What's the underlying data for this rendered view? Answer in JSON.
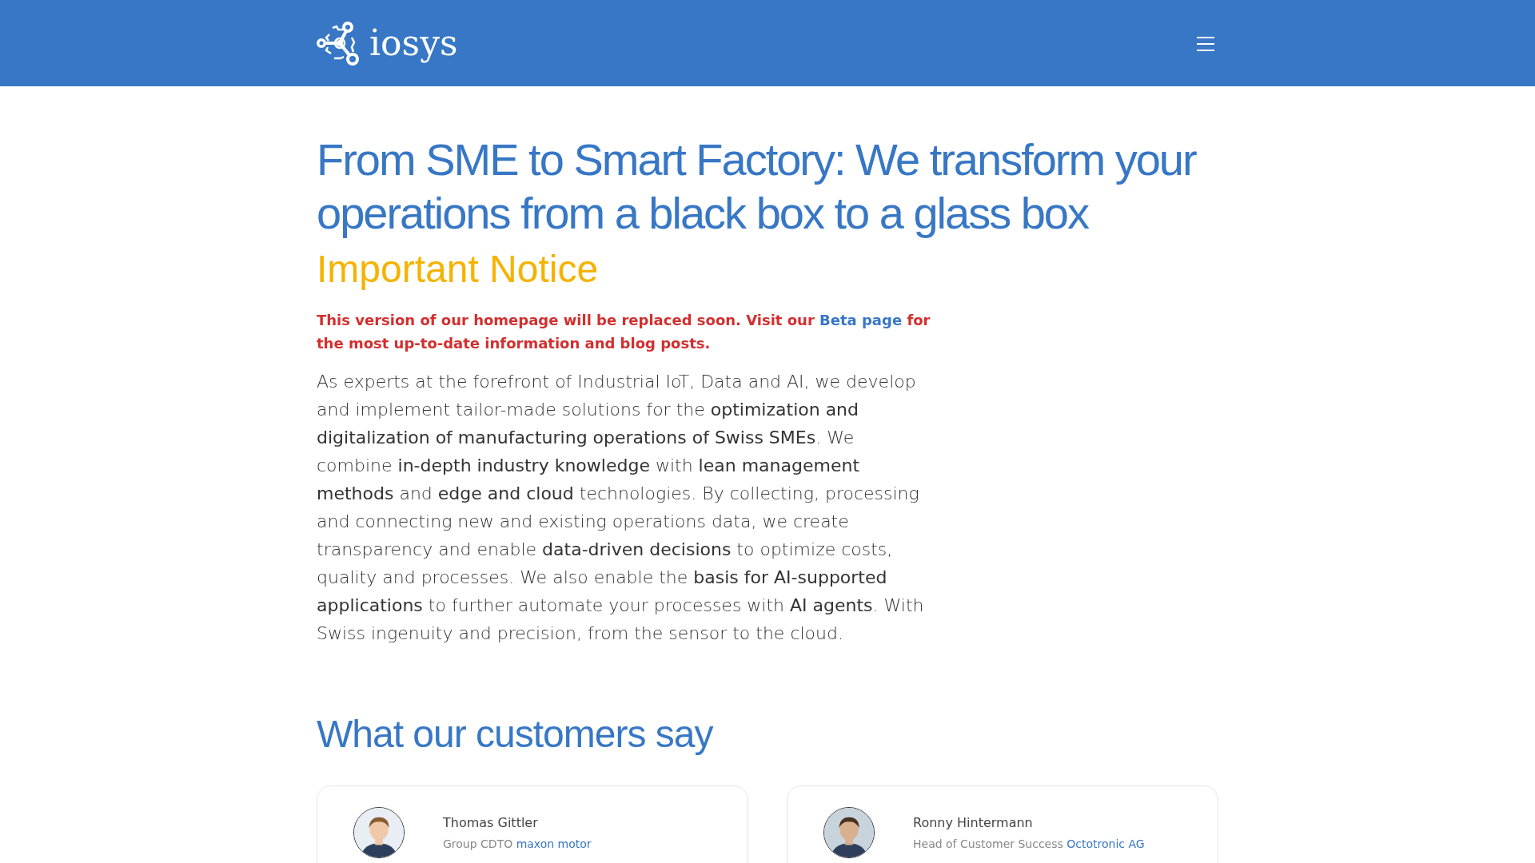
{
  "navbar": {
    "brand": "iosys"
  },
  "hero": {
    "title": "From SME to Smart Factory: We transform your operations from a black box to a glass box"
  },
  "notice": {
    "heading": "Important Notice",
    "before": "This version of our homepage will be replaced soon. Visit our",
    "link": "Beta page",
    "after": "for the most up-to-date information and blog posts."
  },
  "intro": "As experts at the forefront of Industrial IoT, Data and AI, we develop and implement tailor-made solutions for the **optimization and digitalization of manufacturing operations of Swiss SMEs**. We combine **in-depth industry knowledge** with **lean management methods** and **edge and cloud** technologies. By collecting, processing and connecting new and existing operations data, we create transparency and enable **data-driven decisions** to optimize costs, quality and processes. We also enable the **basis for AI-supported applications** to further automate your processes with **AI agents**. With Swiss ingenuity and precision, from the sensor to the cloud.",
  "testimonials": {
    "heading": "What our customers say",
    "items": [
      {
        "name": "Thomas Gittler",
        "role": "Group CDTO",
        "company": "maxon motor"
      },
      {
        "name": "Ronny Hintermann",
        "role": "Head of Customer Success",
        "company": "Octotronic AG"
      }
    ]
  }
}
